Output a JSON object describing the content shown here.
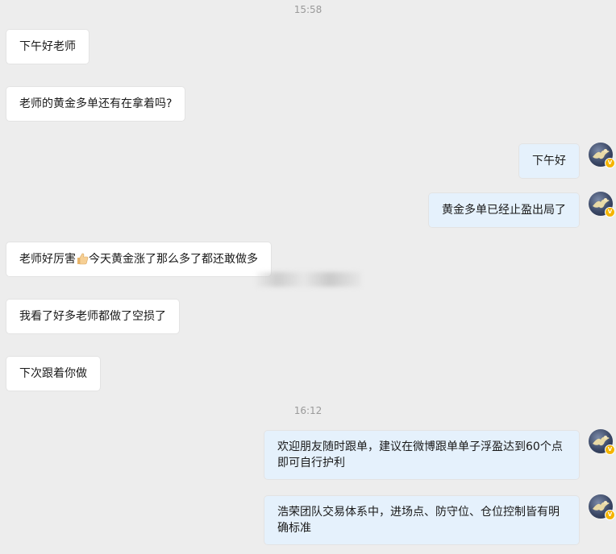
{
  "timestamps": [
    "15:58",
    "16:12"
  ],
  "messages": [
    {
      "side": "in",
      "text": "下午好老师"
    },
    {
      "side": "in",
      "text": "老师的黄金多单还有在拿着吗?"
    },
    {
      "side": "out",
      "text": "下午好"
    },
    {
      "side": "out",
      "text": "黄金多单已经止盈出局了"
    },
    {
      "side": "in",
      "text_before": "老师好厉害",
      "emoji": "thumbs-up-emoji",
      "text_after": "今天黄金涨了那么多了都还敢做多"
    },
    {
      "side": "in",
      "text": "我看了好多老师都做了空损了"
    },
    {
      "side": "in",
      "text": "下次跟着你做"
    },
    {
      "side": "out",
      "text": "欢迎朋友随时跟单，建议在微博跟单单子浮盈达到60个点即可自行护利"
    },
    {
      "side": "out",
      "text": "浩荣团队交易体系中，进场点、防守位、仓位控制皆有明确标准"
    }
  ],
  "avatar": {
    "badge": "V",
    "icon": "eagle-avatar-icon"
  },
  "colors": {
    "background": "#ededed",
    "incoming": "#ffffff",
    "outgoing": "#e5f1fc",
    "badge": "#f4b400"
  }
}
